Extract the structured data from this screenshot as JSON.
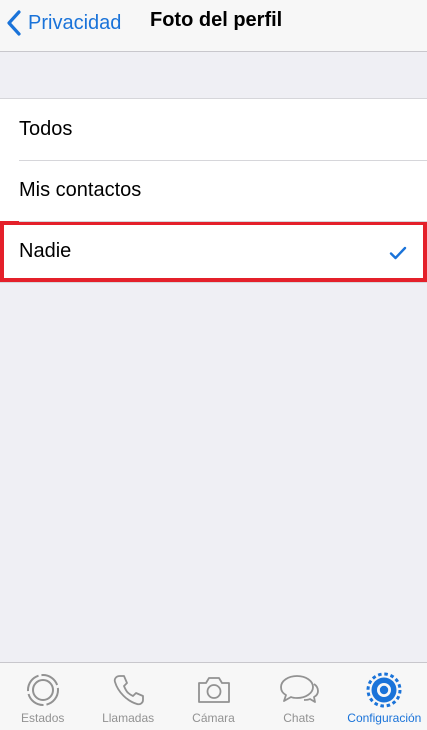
{
  "header": {
    "back_label": "Privacidad",
    "title": "Foto del perfil"
  },
  "options": [
    {
      "label": "Todos",
      "selected": false
    },
    {
      "label": "Mis contactos",
      "selected": false
    },
    {
      "label": "Nadie",
      "selected": true
    }
  ],
  "tabbar": {
    "tabs": [
      {
        "label": "Estados",
        "icon": "status-icon",
        "active": false
      },
      {
        "label": "Llamadas",
        "icon": "phone-icon",
        "active": false
      },
      {
        "label": "Cámara",
        "icon": "camera-icon",
        "active": false
      },
      {
        "label": "Chats",
        "icon": "chat-bubbles-icon",
        "active": false
      },
      {
        "label": "Configuración",
        "icon": "settings-gear-icon",
        "active": true
      }
    ]
  },
  "colors": {
    "accent": "#1a73d9",
    "highlight": "#e4202a",
    "inactive": "#929292",
    "background": "#efeff4"
  }
}
